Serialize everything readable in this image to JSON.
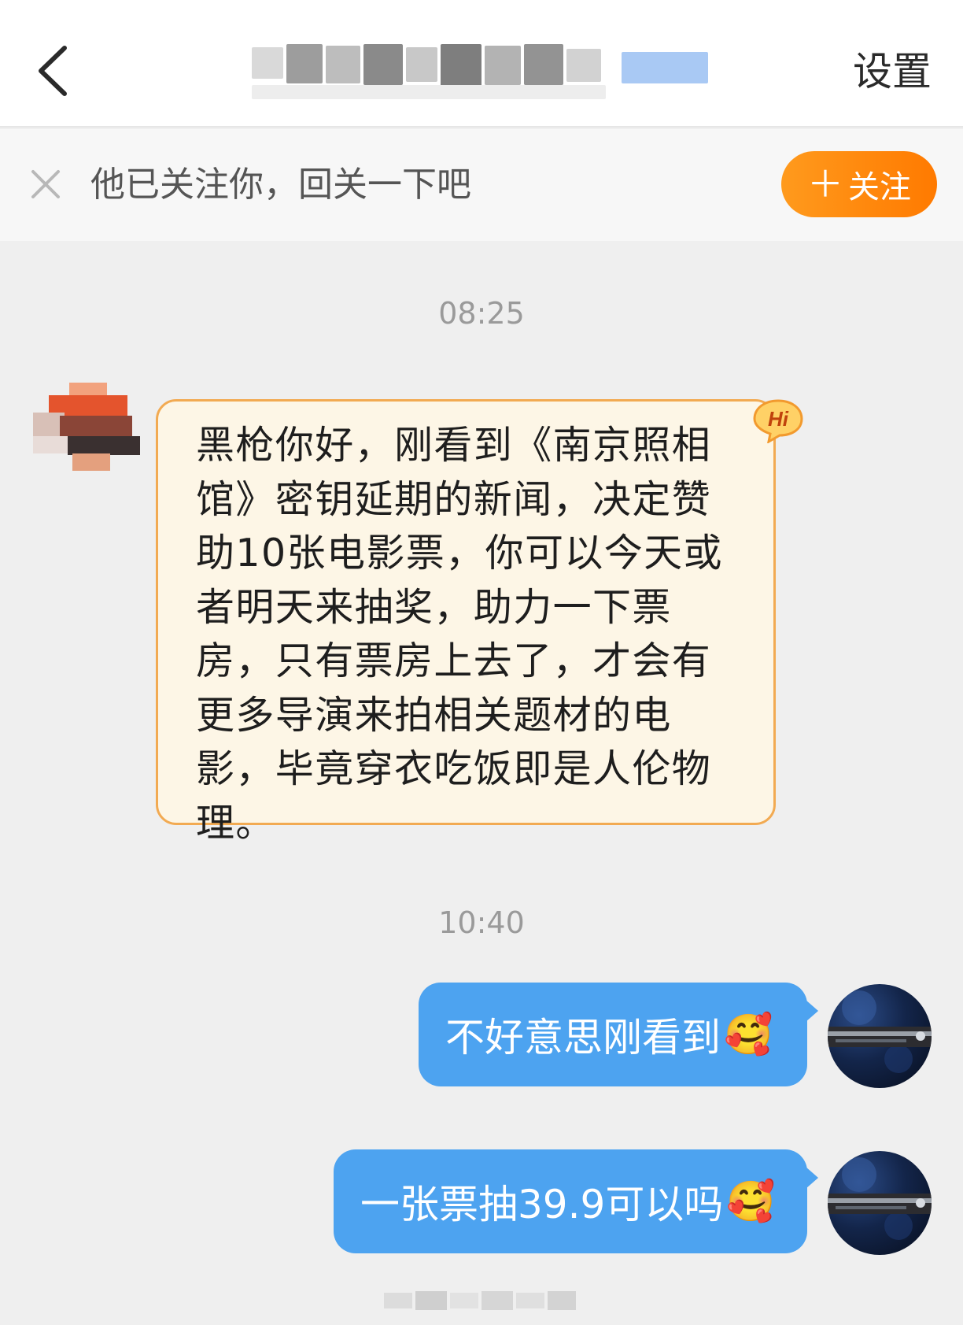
{
  "header": {
    "back_icon": "chevron-left-icon",
    "title_obscured": true,
    "settings_label": "设置"
  },
  "follow_banner": {
    "close_icon": "close-icon",
    "text": "他已关注你，回关一下吧",
    "button_label": "关注",
    "button_icon": "plus-icon",
    "accent_color": "#ff8a0e"
  },
  "messages": [
    {
      "timestamp": "08:25",
      "direction": "incoming",
      "badge": "Hi",
      "text": "黑枪你好，刚看到《南京照相馆》密钥延期的新闻，决定赞助10张电影票，你可以今天或者明天来抽奖，助力一下票房，只有票房上去了，才会有更多导演来拍相关题材的电影，毕竟穿衣吃饭即是人伦物理。"
    },
    {
      "timestamp": "10:40",
      "direction": "outgoing",
      "text": "不好意思刚看到",
      "emoji": "🥰",
      "bubble_color": "#4da3f0"
    },
    {
      "direction": "outgoing",
      "text": "一张票抽39.9可以吗",
      "emoji": "🥰",
      "bubble_color": "#4da3f0"
    }
  ],
  "colors": {
    "background": "#efefef",
    "incoming_bubble": "#fdf6e6",
    "incoming_border": "#f2aa52",
    "outgoing_bubble": "#4da3f0"
  }
}
